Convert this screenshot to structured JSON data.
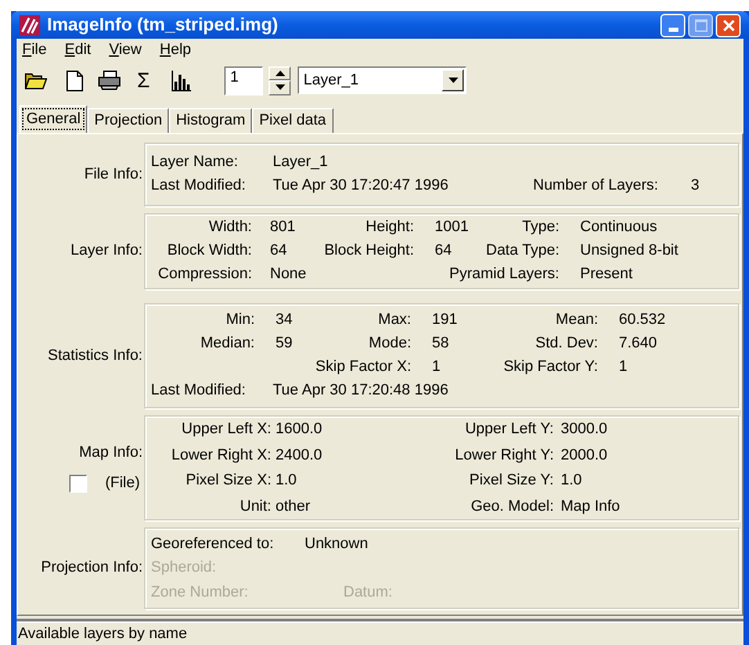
{
  "window": {
    "title": "ImageInfo (tm_striped.img)"
  },
  "menu": [
    "File",
    "Edit",
    "View",
    "Help"
  ],
  "toolbar": {
    "sum_glyph": "Σ",
    "layer_number": "1",
    "layer_name": "Layer_1"
  },
  "tabs": [
    {
      "label": "General",
      "selected": true
    },
    {
      "label": "Projection",
      "selected": false
    },
    {
      "label": "Histogram",
      "selected": false
    },
    {
      "label": "Pixel data",
      "selected": false
    }
  ],
  "sections": [
    {
      "kind": "file",
      "label": "File Info:",
      "rows": [
        {
          "kind": "grid",
          "fields": [
            {
              "label": "Layer Name:",
              "value": "Layer_1"
            }
          ]
        },
        {
          "kind": "grid",
          "fields": [
            {
              "label": "Last Modified:",
              "value": "Tue Apr 30 17:20:47 1996"
            },
            {
              "label": "Number of Layers:",
              "value": "3"
            }
          ]
        }
      ]
    },
    {
      "kind": "layer",
      "label": "Layer Info:",
      "rows": [
        {
          "kind": "grid",
          "fields": [
            {
              "label": "Width:",
              "value": "801"
            },
            {
              "label": "Height:",
              "value": "1001"
            },
            {
              "label": "Type:",
              "value": "Continuous"
            }
          ]
        },
        {
          "kind": "grid",
          "fields": [
            {
              "label": "Block Width:",
              "value": "64"
            },
            {
              "label": "Block Height:",
              "value": "64"
            },
            {
              "label": "Data Type:",
              "value": "Unsigned 8-bit"
            }
          ]
        },
        {
          "kind": "grid",
          "fields": [
            {
              "kind": "cell",
              "label": "Compression:",
              "value": "None"
            },
            {
              "kind": "wide",
              "label": "Pyramid Layers:",
              "value": "Present"
            }
          ]
        }
      ]
    },
    {
      "kind": "stats",
      "label": "Statistics Info:",
      "rows": [
        {
          "kind": "grid",
          "fields": [
            {
              "label": "Min:",
              "value": "34"
            },
            {
              "label": "Max:",
              "value": "191"
            },
            {
              "label": "Mean:",
              "value": "60.532"
            }
          ]
        },
        {
          "kind": "grid",
          "fields": [
            {
              "label": "Median:",
              "value": "59"
            },
            {
              "label": "Mode:",
              "value": "58"
            },
            {
              "label": "Std. Dev:",
              "value": "7.640"
            }
          ]
        },
        {
          "kind": "grid",
          "fields": [
            {
              "kind": "wide",
              "label": "Skip Factor X:",
              "value": "1"
            },
            {
              "kind": "cell",
              "label": "Skip Factor Y:",
              "value": "1"
            }
          ]
        },
        {
          "kind": "line",
          "fields": [
            {
              "label": "Last Modified:",
              "value": "Tue Apr 30 17:20:48 1996"
            }
          ]
        }
      ]
    },
    {
      "kind": "map",
      "label": "Map Info:",
      "checkbox": {
        "label": "(File)",
        "checked": false
      },
      "rows": [
        {
          "kind": "grid",
          "fields": [
            {
              "label": "Upper Left X:",
              "value": "1600.0"
            },
            {
              "label": "Upper Left Y:",
              "value": "3000.0"
            }
          ]
        },
        {
          "kind": "grid",
          "fields": [
            {
              "label": "Lower Right X:",
              "value": "2400.0"
            },
            {
              "label": "Lower Right Y:",
              "value": "2000.0"
            }
          ]
        },
        {
          "kind": "grid",
          "fields": [
            {
              "label": "Pixel Size X:",
              "value": "1.0"
            },
            {
              "label": "Pixel Size Y:",
              "value": "1.0"
            }
          ]
        },
        {
          "kind": "grid",
          "fields": [
            {
              "label": "Unit:",
              "value": "other"
            },
            {
              "label": "Geo. Model:",
              "value": "Map Info"
            }
          ]
        }
      ]
    },
    {
      "kind": "projection",
      "label": "Projection Info:",
      "rows": [
        {
          "kind": "grid",
          "fields": [
            {
              "label": "Georeferenced to:",
              "value": "Unknown",
              "disabled": false
            }
          ]
        },
        {
          "kind": "grid",
          "fields": [
            {
              "label": "Spheroid:",
              "disabled": true
            }
          ]
        },
        {
          "kind": "grid",
          "fields": [
            {
              "label": "Zone Number:",
              "disabled": true
            },
            {
              "label": "Datum:",
              "disabled": true
            }
          ]
        }
      ]
    }
  ],
  "status_bar": "Available layers by name"
}
